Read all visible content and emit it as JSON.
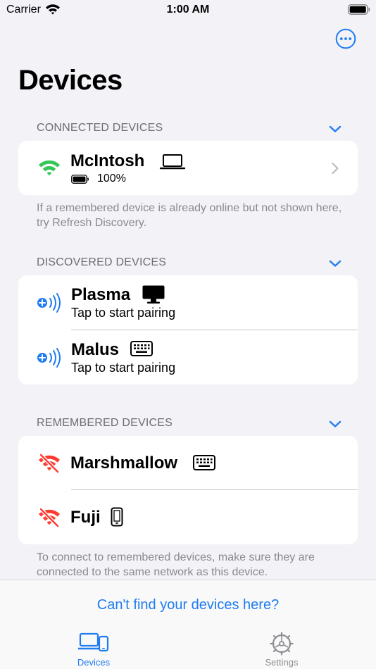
{
  "status_bar": {
    "carrier": "Carrier",
    "time": "1:00 AM"
  },
  "title": "Devices",
  "colors": {
    "accent": "#1f7cf0",
    "connected": "#34c759",
    "disconnected": "#ff3b30",
    "secondary_text": "#6d6d72"
  },
  "connected": {
    "header": "CONNECTED DEVICES",
    "devices": [
      {
        "name": "McIntosh",
        "type_icon": "laptop-icon",
        "battery": "100%",
        "status_icon": "wifi-icon"
      }
    ],
    "footnote": "If a remembered device is already online but not shown here, try Refresh Discovery."
  },
  "discovered": {
    "header": "DISCOVERED DEVICES",
    "devices": [
      {
        "name": "Plasma",
        "type_icon": "desktop-icon",
        "subtitle": "Tap to start pairing",
        "status_icon": "pair-icon"
      },
      {
        "name": "Malus",
        "type_icon": "keyboard-icon",
        "subtitle": "Tap to start pairing",
        "status_icon": "pair-icon"
      }
    ]
  },
  "remembered": {
    "header": "REMEMBERED DEVICES",
    "devices": [
      {
        "name": "Marshmallow",
        "type_icon": "keyboard-icon",
        "status_icon": "wifi-off-icon"
      },
      {
        "name": "Fuji",
        "type_icon": "phone-icon",
        "status_icon": "wifi-off-icon"
      }
    ],
    "footnote": "To connect to remembered devices, make sure they are connected to the same network as this device."
  },
  "help_link": "Can't find your devices here?",
  "tabs": [
    {
      "label": "Devices",
      "icon": "devices-icon",
      "selected": true
    },
    {
      "label": "Settings",
      "icon": "settings-gear-icon",
      "selected": false
    }
  ]
}
